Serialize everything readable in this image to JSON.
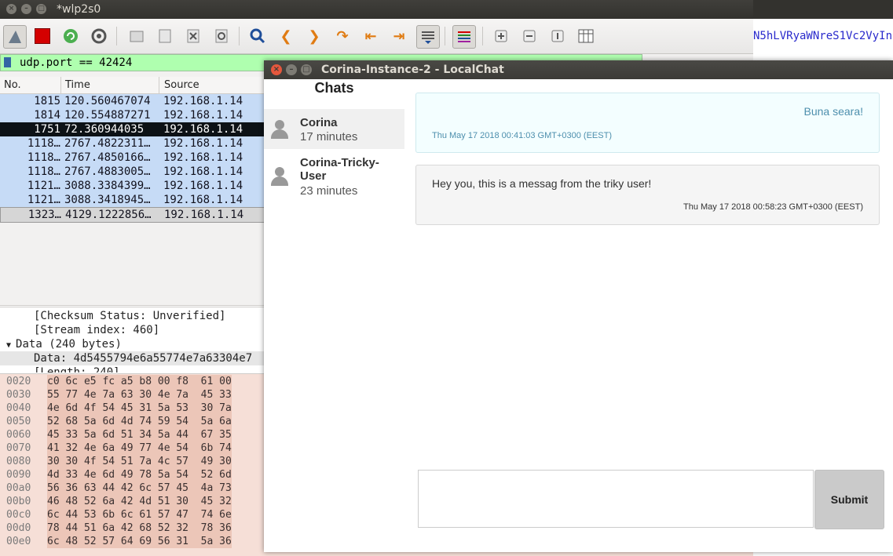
{
  "wireshark": {
    "title": "*wlp2s0",
    "filter": "udp.port == 42424",
    "columns": [
      "No.",
      "Time",
      "Source"
    ],
    "rows": [
      {
        "no": "1815",
        "time": "120.560467074",
        "source": "192.168.1.14"
      },
      {
        "no": "1814",
        "time": "120.554887271",
        "source": "192.168.1.14"
      },
      {
        "no": "1751",
        "time": "72.360944035",
        "source": "192.168.1.14"
      },
      {
        "no": "1118…",
        "time": "2767.4822311…",
        "source": "192.168.1.14"
      },
      {
        "no": "1118…",
        "time": "2767.4850166…",
        "source": "192.168.1.14"
      },
      {
        "no": "1118…",
        "time": "2767.4883005…",
        "source": "192.168.1.14"
      },
      {
        "no": "1121…",
        "time": "3088.3384399…",
        "source": "192.168.1.14"
      },
      {
        "no": "1121…",
        "time": "3088.3418945…",
        "source": "192.168.1.14"
      },
      {
        "no": "1323…",
        "time": "4129.1222856…",
        "source": "192.168.1.14"
      }
    ],
    "details": [
      "[Checksum Status: Unverified]",
      "[Stream index: 460]",
      "Data (240 bytes)",
      "Data: 4d5455794e6a55774e7a63304e7",
      "[Length: 240]"
    ],
    "hex_rows": [
      {
        "offset": "0020",
        "bytes": "c0 6c e5 fc a5 b8 00 f8  61 00"
      },
      {
        "offset": "0030",
        "bytes": "55 77 4e 7a 63 30 4e 7a  45 33"
      },
      {
        "offset": "0040",
        "bytes": "4e 6d 4f 54 45 31 5a 53  30 7a"
      },
      {
        "offset": "0050",
        "bytes": "52 68 5a 6d 4d 74 59 54  5a 6a"
      },
      {
        "offset": "0060",
        "bytes": "45 33 5a 6d 51 34 5a 44  67 35"
      },
      {
        "offset": "0070",
        "bytes": "41 32 4e 6a 49 77 4e 54  6b 74"
      },
      {
        "offset": "0080",
        "bytes": "30 30 4f 54 51 7a 4c 57  49 30"
      },
      {
        "offset": "0090",
        "bytes": "4d 33 4e 6d 49 78 5a 54  52 6d"
      },
      {
        "offset": "00a0",
        "bytes": "56 36 63 44 42 6c 57 45  4a 73"
      },
      {
        "offset": "00b0",
        "bytes": "46 48 52 6a 42 4d 51 30  45 32"
      },
      {
        "offset": "00c0",
        "bytes": "6c 44 53 6b 6c 61 57 47  74 6e"
      },
      {
        "offset": "00d0",
        "bytes": "78 44 51 6a 42 68 52 32  78 36"
      },
      {
        "offset": "00e0",
        "bytes": "6c 48 52 57 64 69 56 31  5a 36"
      }
    ],
    "right_text": "N5hLVRyaWNreS1Vc2VyIn"
  },
  "chat_window": {
    "title": "Corina-Instance-2 - LocalChat",
    "sidebar_heading": "Chats",
    "chats": [
      {
        "name": "Corina",
        "time": "17 minutes"
      },
      {
        "name": "Corina-Tricky-User",
        "time": "23 minutes"
      }
    ],
    "messages": [
      {
        "text": "Buna seara!",
        "timestamp": "Thu May 17 2018 00:41:03 GMT+0300 (EEST)"
      },
      {
        "text": "Hey you, this is a messag from the triky user!",
        "timestamp": "Thu May 17 2018 00:58:23 GMT+0300 (EEST)"
      }
    ],
    "composer_value": "",
    "submit_label": "Submit"
  },
  "colors": {
    "filter_bg": "#afffaf",
    "row_bg": "#c6dbf6",
    "selected_row_bg": "#0d1216",
    "hex_bg": "#f6dfd7",
    "mine_message_bg": "#f3feff",
    "mine_message_text": "#4d8fad",
    "submit_bg": "#cacaca"
  }
}
